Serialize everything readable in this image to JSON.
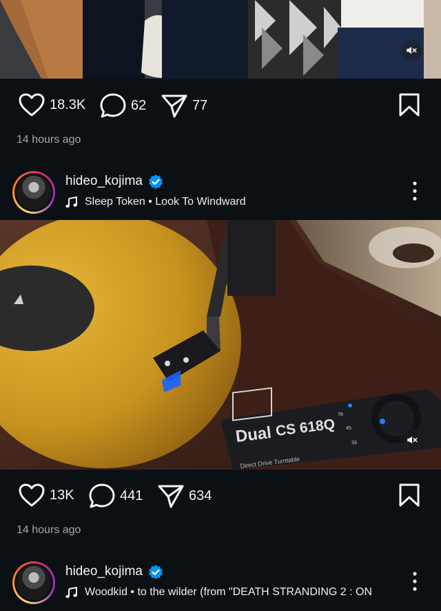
{
  "posts": [
    {
      "media": {
        "type": "photo",
        "muted": true,
        "mute_icon": "speaker-muted-icon"
      },
      "likes": "18.3K",
      "comments": "62",
      "shares": "77",
      "time": "14 hours ago"
    },
    {
      "username": "hideo_kojima",
      "verified": true,
      "music": "Sleep Token • Look To Windward",
      "media": {
        "type": "photo",
        "muted": true,
        "mute_icon": "speaker-muted-icon",
        "turntable": {
          "brand": "Dual",
          "model": "CS 618Q",
          "subtitle": "Direct Drive Turntable",
          "speed_78": "78",
          "speed_45": "45",
          "speed_33": "33"
        }
      },
      "likes": "13K",
      "comments": "441",
      "shares": "634",
      "time": "14 hours ago"
    },
    {
      "username": "hideo_kojima",
      "verified": true,
      "music": "Woodkid • to the wilder (from \"DEATH STRANDING 2 : ON"
    }
  ],
  "colors": {
    "background": "#0b1014",
    "verified": "#0095f6",
    "secondary_text": "#a8a8a8"
  }
}
